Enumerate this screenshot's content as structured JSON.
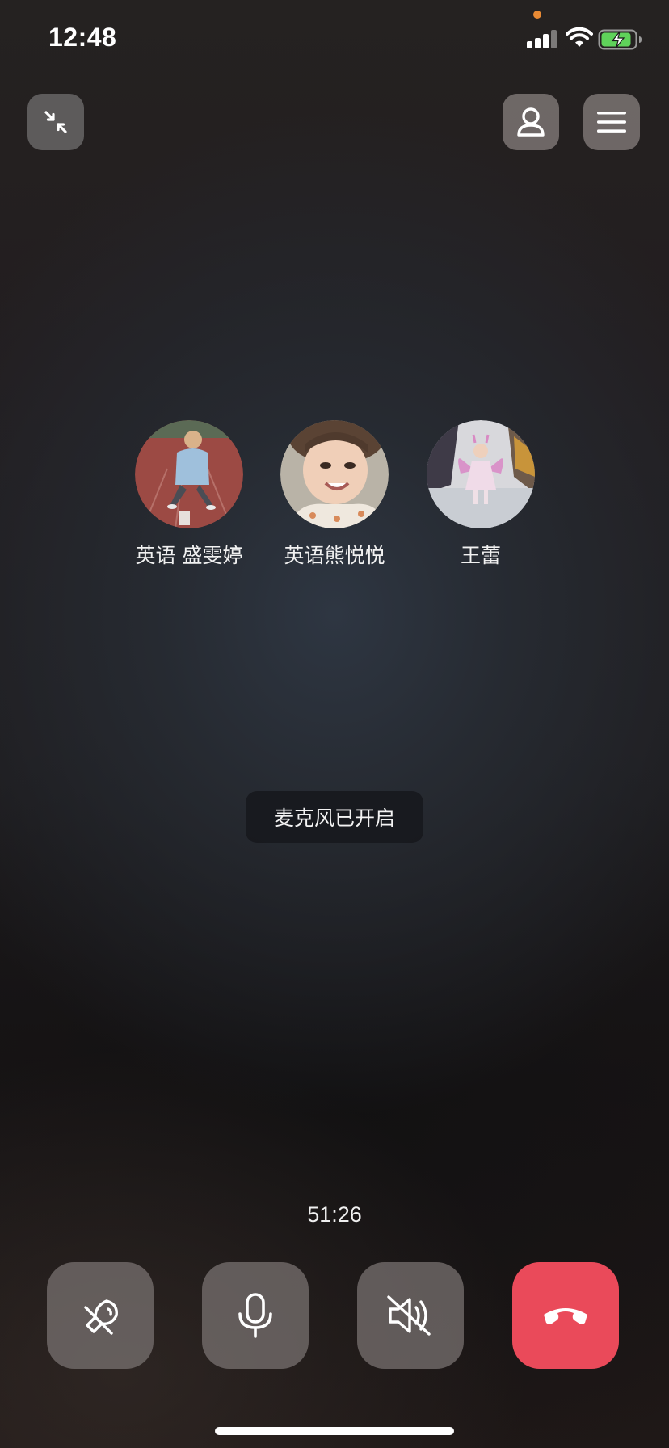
{
  "status_bar": {
    "time": "12:48",
    "icons": [
      "signal-icon",
      "wifi-icon",
      "battery-charging-icon"
    ],
    "recording_indicator_color": "#e88a34"
  },
  "top_bar": {
    "left_icon": "minimize-icon",
    "right_icons": [
      "contact-icon",
      "menu-icon"
    ]
  },
  "participants": [
    {
      "name": "英语 盛雯婷",
      "avatar": "child-on-red-track-photo"
    },
    {
      "name": "英语熊悦悦",
      "avatar": "smiling-child-photo"
    },
    {
      "name": "王蕾",
      "avatar": "girl-in-fairy-costume-photo"
    }
  ],
  "toast": {
    "text": "麦克风已开启"
  },
  "call": {
    "duration": "51:26"
  },
  "controls": [
    {
      "name": "speaker-toggle",
      "icon": "speaker-off-icon"
    },
    {
      "name": "microphone-toggle",
      "icon": "microphone-icon"
    },
    {
      "name": "volume-mute",
      "icon": "volume-muted-icon"
    },
    {
      "name": "hang-up",
      "icon": "phone-hangup-icon",
      "color": "#ea4a5a"
    }
  ]
}
